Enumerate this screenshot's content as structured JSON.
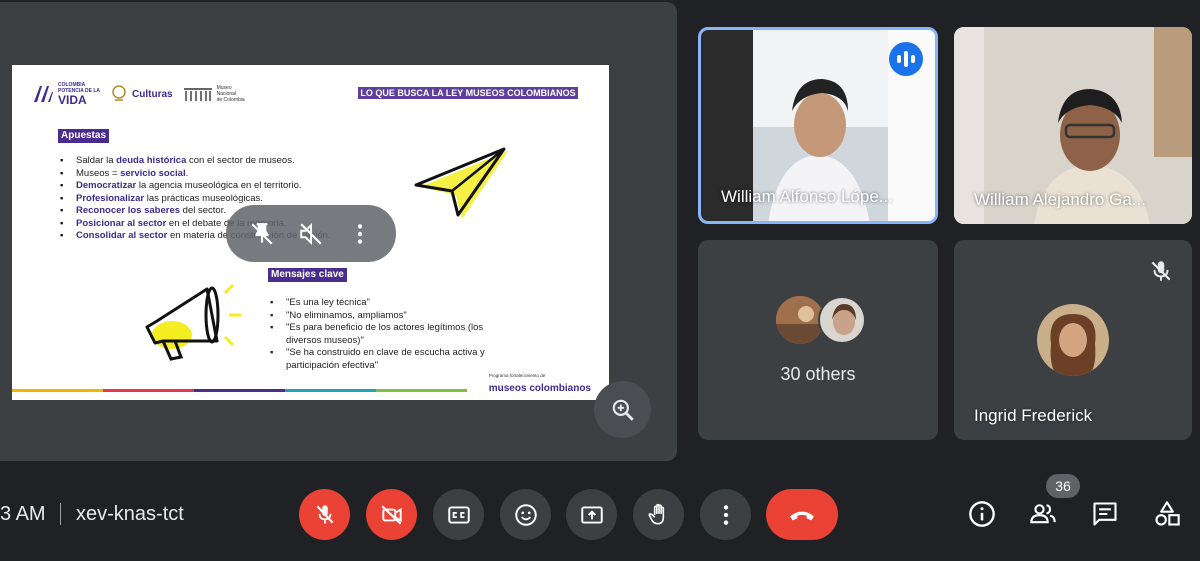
{
  "presentation": {
    "slide": {
      "logos": {
        "colombia_small": "COLOMBIA",
        "potencia": "POTENCIA DE LA",
        "vida": "VIDA",
        "culturas": "Culturas",
        "museo_line1": "Museo",
        "museo_line2": "Nacional",
        "museo_line3": "de Colombia"
      },
      "title": "LO QUE BUSCA LA LEY MUSEOS COLOMBIANOS",
      "apuestas_header": "Apuestas",
      "apuestas": [
        {
          "hl": "",
          "pre": "Saldar la ",
          "hl2": "deuda histórica",
          "post": " con el sector de museos."
        },
        {
          "pre": "Museos = ",
          "hl2": "servicio social",
          "post": "."
        },
        {
          "pre": "",
          "hl2": "Democratizar",
          "post": " la agencia museológica en el territorio."
        },
        {
          "pre": "",
          "hl2": "Profesionalizar",
          "post": " las prácticas museológicas."
        },
        {
          "pre": "",
          "hl2": "Reconocer los saberes",
          "post": " del sector."
        },
        {
          "pre": "",
          "hl2": "Posicionar al sector",
          "post": " en el debate de la memoria."
        },
        {
          "pre": "",
          "hl2": "Consolidar al sector",
          "post": " en materia de construcción de nación."
        }
      ],
      "mensajes_header": "Mensajes clave",
      "mensajes": [
        "\"Es una ley técnica\"",
        "\"No eliminamos, ampliamos\"",
        "\"Es para beneficio de los actores legítimos (los diversos museos)\"",
        "\"Se ha construido en clave de escucha activa y participación efectiva\""
      ],
      "footer_small": "Programa fortalecimiento de",
      "footer_big": "museos colombianos",
      "bar_colors": [
        "#f4b400",
        "#e8344e",
        "#4a2c8c",
        "#1aa6b7",
        "#7cc242"
      ]
    }
  },
  "participants": {
    "tile1_name": "William Alfonso Lópe...",
    "tile2_name": "William Alejandro Ga...",
    "others_label": "30 others",
    "tile4_name": "Ingrid Frederick"
  },
  "bottom_bar": {
    "time": "3 AM",
    "meeting_code": "xev-knas-tct",
    "people_count": "36"
  },
  "colors": {
    "accent_blue": "#8ab4f8",
    "danger_red": "#ea4335",
    "control_gray": "#3c4043"
  }
}
